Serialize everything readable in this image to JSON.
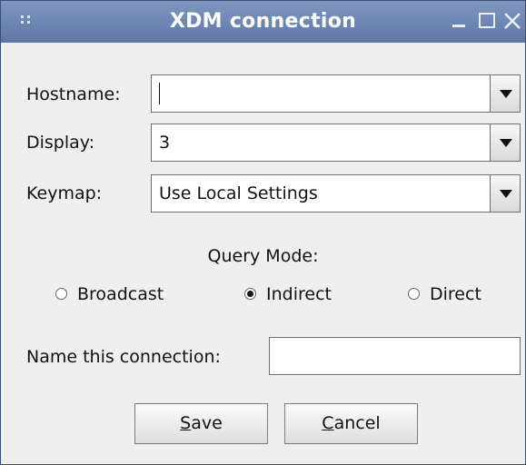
{
  "window": {
    "title": "XDM connection"
  },
  "form": {
    "hostname": {
      "label": "Hostname:",
      "value": ""
    },
    "display": {
      "label": "Display:",
      "value": "3"
    },
    "keymap": {
      "label": "Keymap:",
      "value": "Use Local Settings"
    }
  },
  "query_mode": {
    "title": "Query Mode:",
    "options": [
      {
        "label": "Broadcast",
        "selected": false
      },
      {
        "label": "Indirect",
        "selected": true
      },
      {
        "label": "Direct",
        "selected": false
      }
    ]
  },
  "connection_name": {
    "label": "Name this connection:",
    "value": ""
  },
  "buttons": {
    "save": {
      "mnemonic": "S",
      "rest": "ave"
    },
    "cancel": {
      "mnemonic": "C",
      "rest": "ancel"
    }
  },
  "icons": [
    "grip-icon",
    "minimize-icon",
    "maximize-icon",
    "close-icon",
    "dropdown-arrow-icon",
    "radio-icon"
  ],
  "colors": {
    "titlebar": "#6d84b2",
    "window_bg": "#efefef",
    "text": "#111111"
  }
}
